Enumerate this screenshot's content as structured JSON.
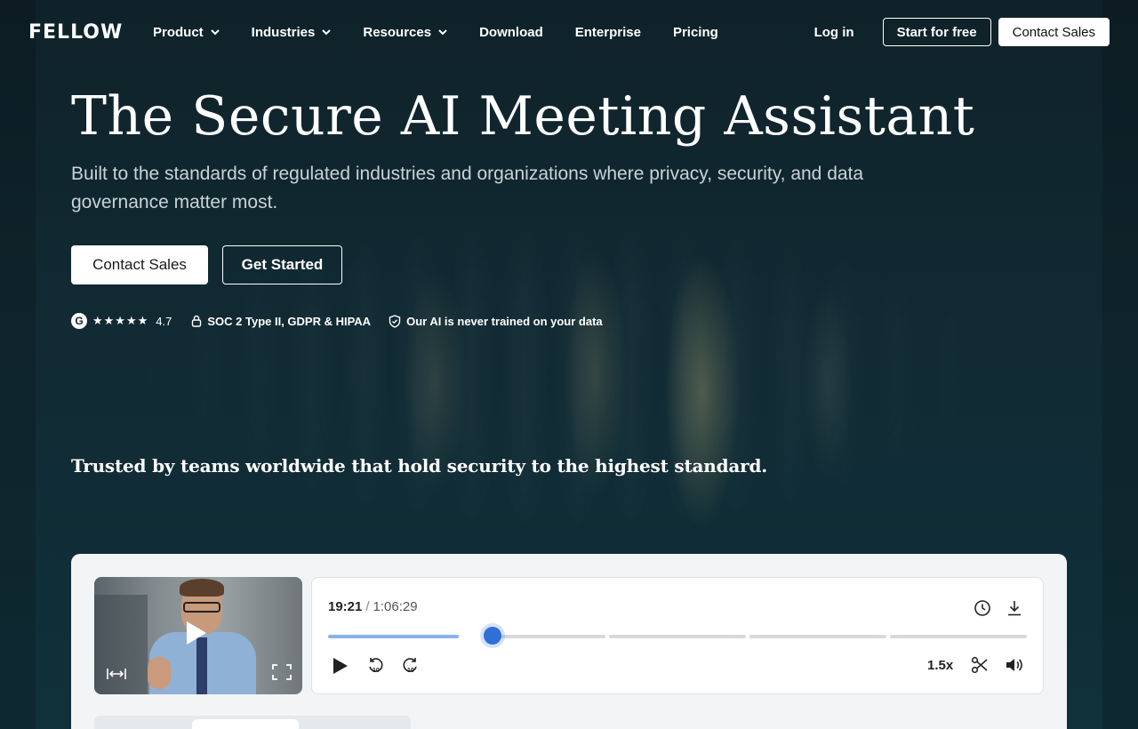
{
  "brand": {
    "logo_text": "FELLOW"
  },
  "nav": {
    "items": [
      {
        "label": "Product",
        "dropdown": true
      },
      {
        "label": "Industries",
        "dropdown": true
      },
      {
        "label": "Resources",
        "dropdown": true
      },
      {
        "label": "Download",
        "dropdown": false
      },
      {
        "label": "Enterprise",
        "dropdown": false
      },
      {
        "label": "Pricing",
        "dropdown": false
      }
    ],
    "login": "Log in",
    "start_free": "Start for free",
    "contact_sales": "Contact Sales"
  },
  "hero": {
    "title": "The Secure AI Meeting Assistant",
    "subtitle": "Built to the standards of regulated industries and organizations where privacy, security, and data governance matter most.",
    "cta_primary": "Contact Sales",
    "cta_secondary": "Get Started"
  },
  "badges": {
    "g2_letter": "G",
    "stars": "★★★★★",
    "rating": "4.7",
    "compliance": "SOC 2 Type II, GDPR & HIPAA",
    "ai_privacy": "Our AI is never trained on your data"
  },
  "trusted": "Trusted by teams worldwide that hold security to the highest standard.",
  "player": {
    "current_time": "19:21",
    "separator": "/",
    "total_time": "1:06:29",
    "progress_fraction": 0.236,
    "speed": "1.5x",
    "rewind_seconds": "10",
    "forward_seconds": "10",
    "accent_color": "#2f6fd8"
  },
  "icons": {
    "search": "none",
    "list": [
      "chevron-down-icon",
      "g2-icon",
      "lock-icon",
      "shield-check-icon",
      "play-icon",
      "expand-horizontal-icon",
      "fullscreen-icon",
      "clock-icon",
      "download-icon",
      "rewind-10-icon",
      "forward-10-icon",
      "scissors-icon",
      "volume-icon"
    ]
  }
}
